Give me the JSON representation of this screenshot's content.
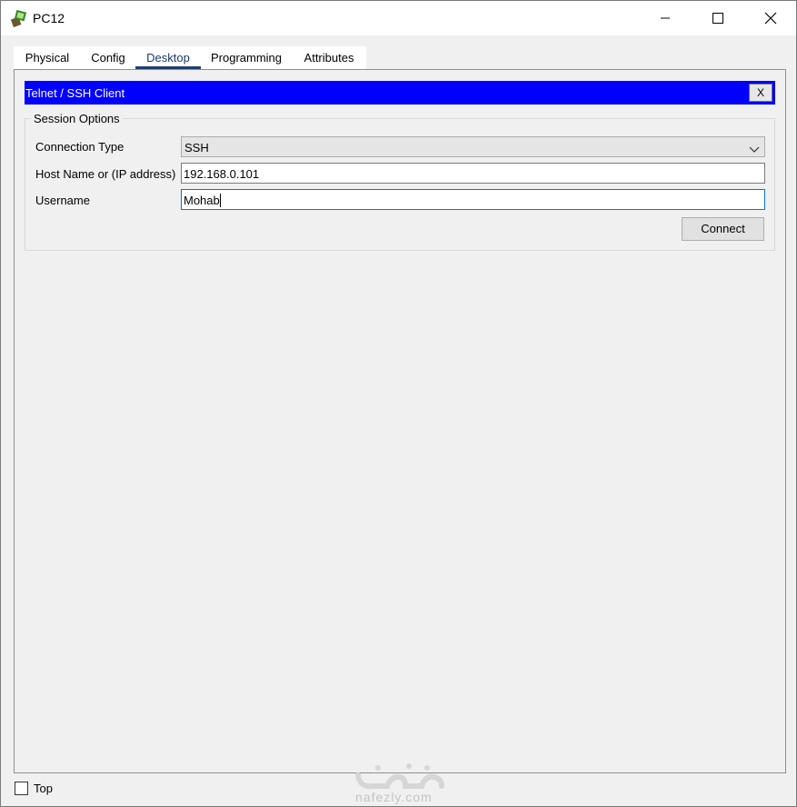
{
  "window": {
    "title": "PC12",
    "controls": [
      "minimize-icon",
      "maximize-icon",
      "close-icon"
    ]
  },
  "tabs": [
    {
      "label": "Physical",
      "active": false
    },
    {
      "label": "Config",
      "active": false
    },
    {
      "label": "Desktop",
      "active": true
    },
    {
      "label": "Programming",
      "active": false
    },
    {
      "label": "Attributes",
      "active": false
    }
  ],
  "panel": {
    "title": "Telnet / SSH Client",
    "close_label": "X",
    "header_color": "#0000ff"
  },
  "session_options": {
    "legend": "Session Options",
    "connection_type_label": "Connection Type",
    "connection_type_value": "SSH",
    "host_label": "Host Name or (IP address)",
    "host_value": "192.168.0.101",
    "username_label": "Username",
    "username_value": "Mohab",
    "connect_label": "Connect"
  },
  "footer": {
    "top_label": "Top",
    "top_checked": false
  },
  "watermark": {
    "text": "nafezly.com"
  }
}
